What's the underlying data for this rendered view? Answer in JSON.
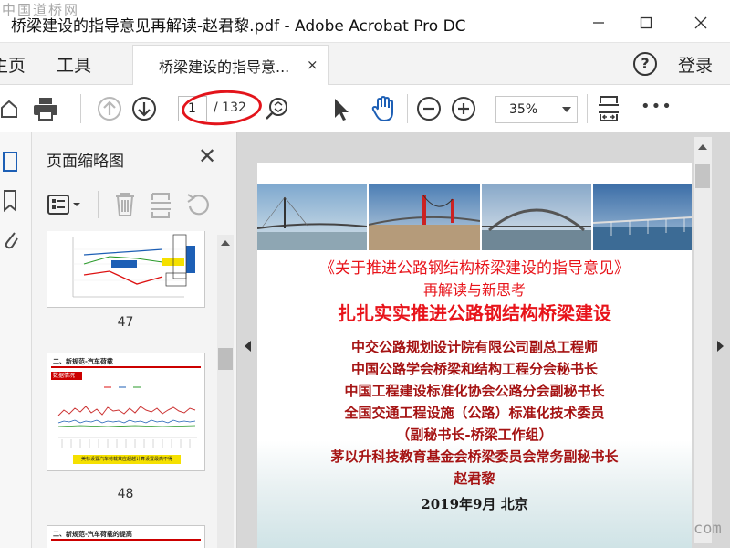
{
  "window": {
    "title": "桥梁建设的指导意见再解读-赵君黎.pdf - Adobe Acrobat Pro DC",
    "minimize_icon": "minimize-icon",
    "maximize_icon": "maximize-icon",
    "close_icon": "close-icon"
  },
  "menu": {
    "home_label": "主页",
    "tools_label": "工具",
    "tab_label": "桥梁建设的指导意...",
    "tab_close": "×",
    "help_label": "?",
    "login_label": "登录"
  },
  "toolbar": {
    "current_page": "1",
    "page_total": "/ 132",
    "zoom_value": "35%",
    "more_label": "•••"
  },
  "panel": {
    "title": "页面缩略图",
    "close": "✕",
    "thumbnails": [
      {
        "page_number": "47"
      },
      {
        "page_number": "48",
        "heading": "二、新规范-汽车荷载",
        "subheading": "数据情况",
        "footer_note": "美标设置汽车荷载效应超越计算设置最高不得"
      },
      {
        "heading": "二、新规范-汽车荷载的提高"
      }
    ]
  },
  "document": {
    "line1": "《关于推进公路钢结构桥梁建设的指导意见》",
    "line2": "再解读与新思考",
    "line3": "扎扎实实推进公路钢结构桥梁建设",
    "line4": "中交公路规划设计院有限公司副总工程师",
    "line5": "中国公路学会桥梁和结构工程分会秘书长",
    "line6": "中国工程建设标准化协会公路分会副秘书长",
    "line7": "全国交通工程设施（公路）标准化技术委员",
    "line8": "（副秘书长-桥梁工作组）",
    "line9": "茅以升科技教育基金会桥梁委员会常务副秘书长",
    "line10": "赵君黎",
    "line11": "2019年9月  北京"
  },
  "watermark": {
    "top_left": "中国道桥网",
    "bottom_right": "com"
  },
  "colors": {
    "title_red": "#e8141b",
    "author_red": "#a51313",
    "dark_text": "#1a1a1a",
    "accent_blue": "#1d5fb5"
  }
}
